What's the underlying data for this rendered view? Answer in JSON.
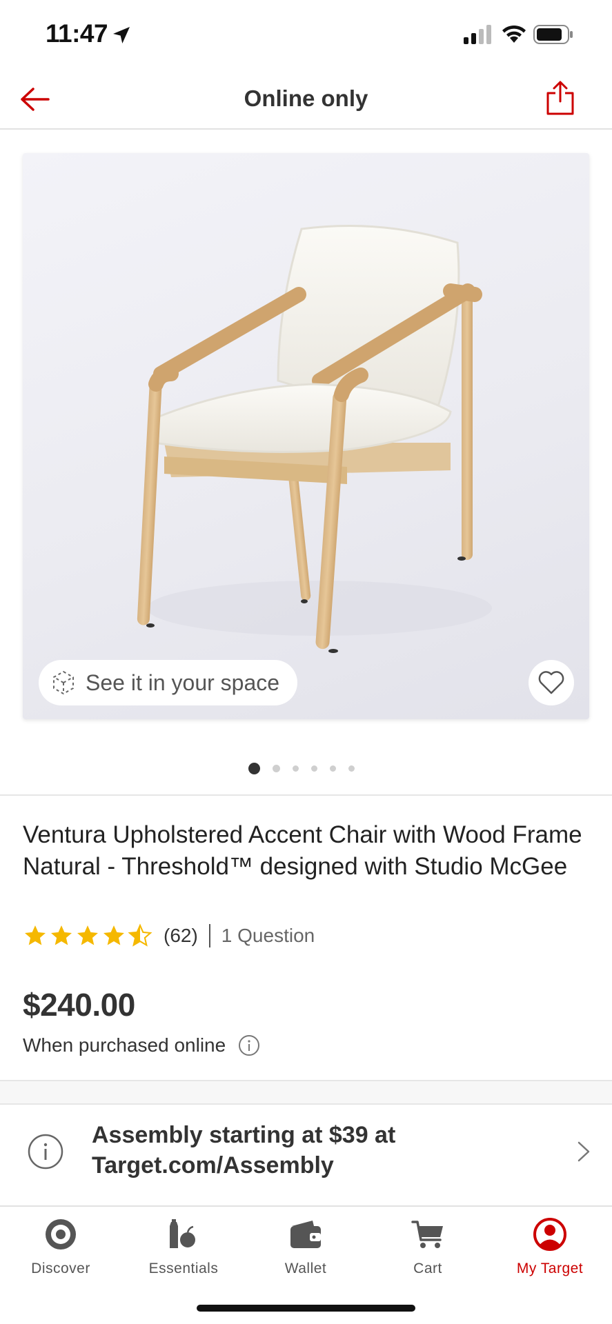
{
  "status_bar": {
    "time": "11:47"
  },
  "header": {
    "title": "Online only"
  },
  "product_image": {
    "ar_label": "See it in your space",
    "page_count": 6,
    "active_page": 0
  },
  "product": {
    "title": "Ventura Upholstered Accent Chair with Wood Frame Natural - Threshold™ designed with Studio McGee",
    "rating": 4.5,
    "rating_count": "(62)",
    "questions": "1 Question",
    "price": "$240.00",
    "price_note": "When purchased online"
  },
  "assembly": {
    "text": "Assembly starting at $39 at Target.com/Assembly"
  },
  "bottom_nav": {
    "items": [
      {
        "label": "Discover",
        "icon": "target-bullseye-icon"
      },
      {
        "label": "Essentials",
        "icon": "essentials-icon"
      },
      {
        "label": "Wallet",
        "icon": "wallet-icon"
      },
      {
        "label": "Cart",
        "icon": "cart-icon"
      },
      {
        "label": "My Target",
        "icon": "profile-icon"
      }
    ],
    "active_index": 4
  },
  "colors": {
    "brand_red": "#cc0000",
    "star_gold": "#f5b800",
    "text_dark": "#333333"
  }
}
